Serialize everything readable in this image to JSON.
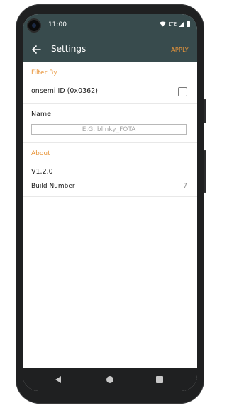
{
  "status_bar": {
    "time": "11:00",
    "network": "LTE"
  },
  "app_bar": {
    "title": "Settings",
    "apply_label": "APPLY"
  },
  "filter_by": {
    "header": "Filter By",
    "onsemi_id_label": "onsemi ID (0x0362)",
    "onsemi_id_checked": false,
    "name_label": "Name",
    "name_value": "",
    "name_placeholder": "E.G. blinky_FOTA"
  },
  "about": {
    "header": "About",
    "version": "V1.2.0",
    "build_number_label": "Build Number",
    "build_number_value": "7"
  },
  "colors": {
    "app_bar": "#384b4d",
    "accent": "#e8953a"
  }
}
